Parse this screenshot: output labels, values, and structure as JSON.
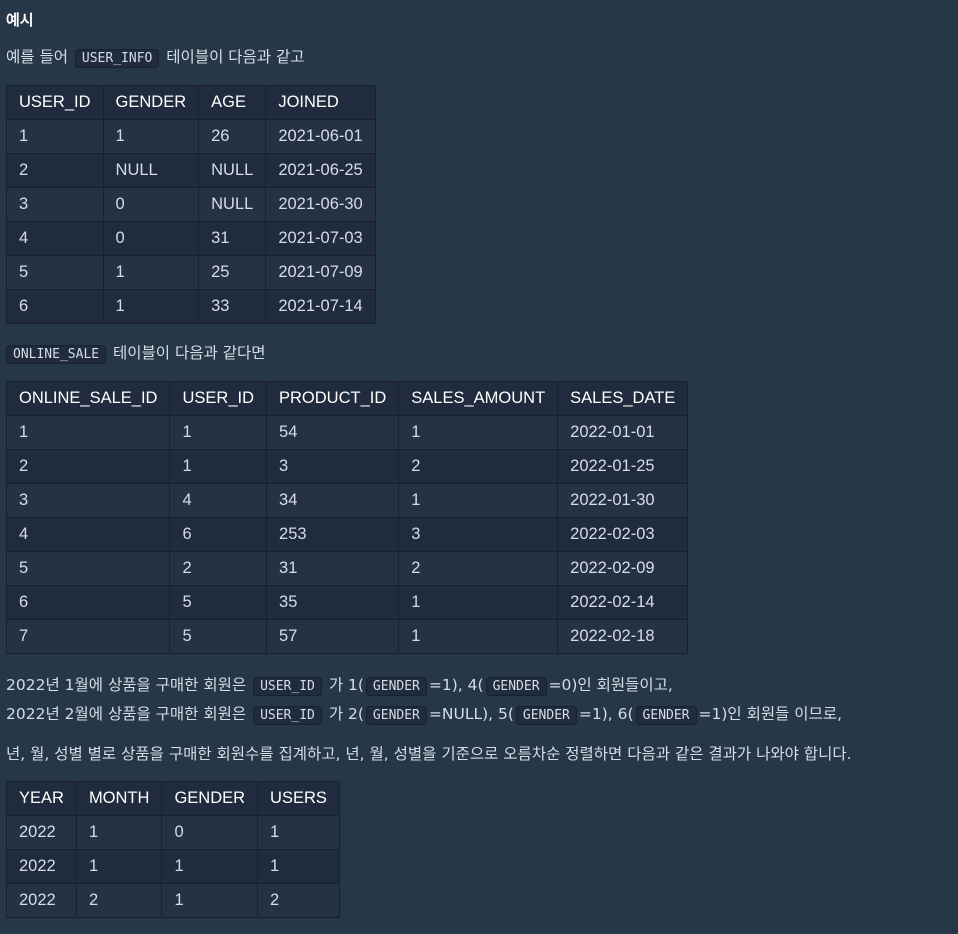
{
  "heading": "예시",
  "intro": {
    "prefix": "예를 들어",
    "code": "USER_INFO",
    "suffix": "테이블이 다음과 같고"
  },
  "user_info_table": {
    "headers": [
      "USER_ID",
      "GENDER",
      "AGE",
      "JOINED"
    ],
    "rows": [
      [
        "1",
        "1",
        "26",
        "2021-06-01"
      ],
      [
        "2",
        "NULL",
        "NULL",
        "2021-06-25"
      ],
      [
        "3",
        "0",
        "NULL",
        "2021-06-30"
      ],
      [
        "4",
        "0",
        "31",
        "2021-07-03"
      ],
      [
        "5",
        "1",
        "25",
        "2021-07-09"
      ],
      [
        "6",
        "1",
        "33",
        "2021-07-14"
      ]
    ]
  },
  "online_sale_intro": {
    "code": "ONLINE_SALE",
    "suffix": "테이블이 다음과 같다면"
  },
  "online_sale_table": {
    "headers": [
      "ONLINE_SALE_ID",
      "USER_ID",
      "PRODUCT_ID",
      "SALES_AMOUNT",
      "SALES_DATE"
    ],
    "rows": [
      [
        "1",
        "1",
        "54",
        "1",
        "2022-01-01"
      ],
      [
        "2",
        "1",
        "3",
        "2",
        "2022-01-25"
      ],
      [
        "3",
        "4",
        "34",
        "1",
        "2022-01-30"
      ],
      [
        "4",
        "6",
        "253",
        "3",
        "2022-02-03"
      ],
      [
        "5",
        "2",
        "31",
        "2",
        "2022-02-09"
      ],
      [
        "6",
        "5",
        "35",
        "1",
        "2022-02-14"
      ],
      [
        "7",
        "5",
        "57",
        "1",
        "2022-02-18"
      ]
    ]
  },
  "explanation": {
    "line1": {
      "t1": "2022년 1월에 상품을 구매한 회원은",
      "c1": "USER_ID",
      "t2": "가 1(",
      "c2": "GENDER",
      "t3": "=1), 4(",
      "c3": "GENDER",
      "t4": "=0)인 회원들이고,"
    },
    "line2": {
      "t1": "2022년 2월에 상품을 구매한 회원은",
      "c1": "USER_ID",
      "t2": "가 2(",
      "c2": "GENDER",
      "t3": "=NULL), 5(",
      "c3": "GENDER",
      "t4": "=1), 6(",
      "c4": "GENDER",
      "t5": "=1)인 회원들 이므로,"
    },
    "line3": "년, 월, 성별 별로 상품을 구매한 회원수를 집계하고, 년, 월, 성별을 기준으로 오름차순 정렬하면 다음과 같은 결과가 나와야 합니다."
  },
  "result_table": {
    "headers": [
      "YEAR",
      "MONTH",
      "GENDER",
      "USERS"
    ],
    "rows": [
      [
        "2022",
        "1",
        "0",
        "1"
      ],
      [
        "2022",
        "1",
        "1",
        "1"
      ],
      [
        "2022",
        "2",
        "1",
        "2"
      ]
    ]
  }
}
